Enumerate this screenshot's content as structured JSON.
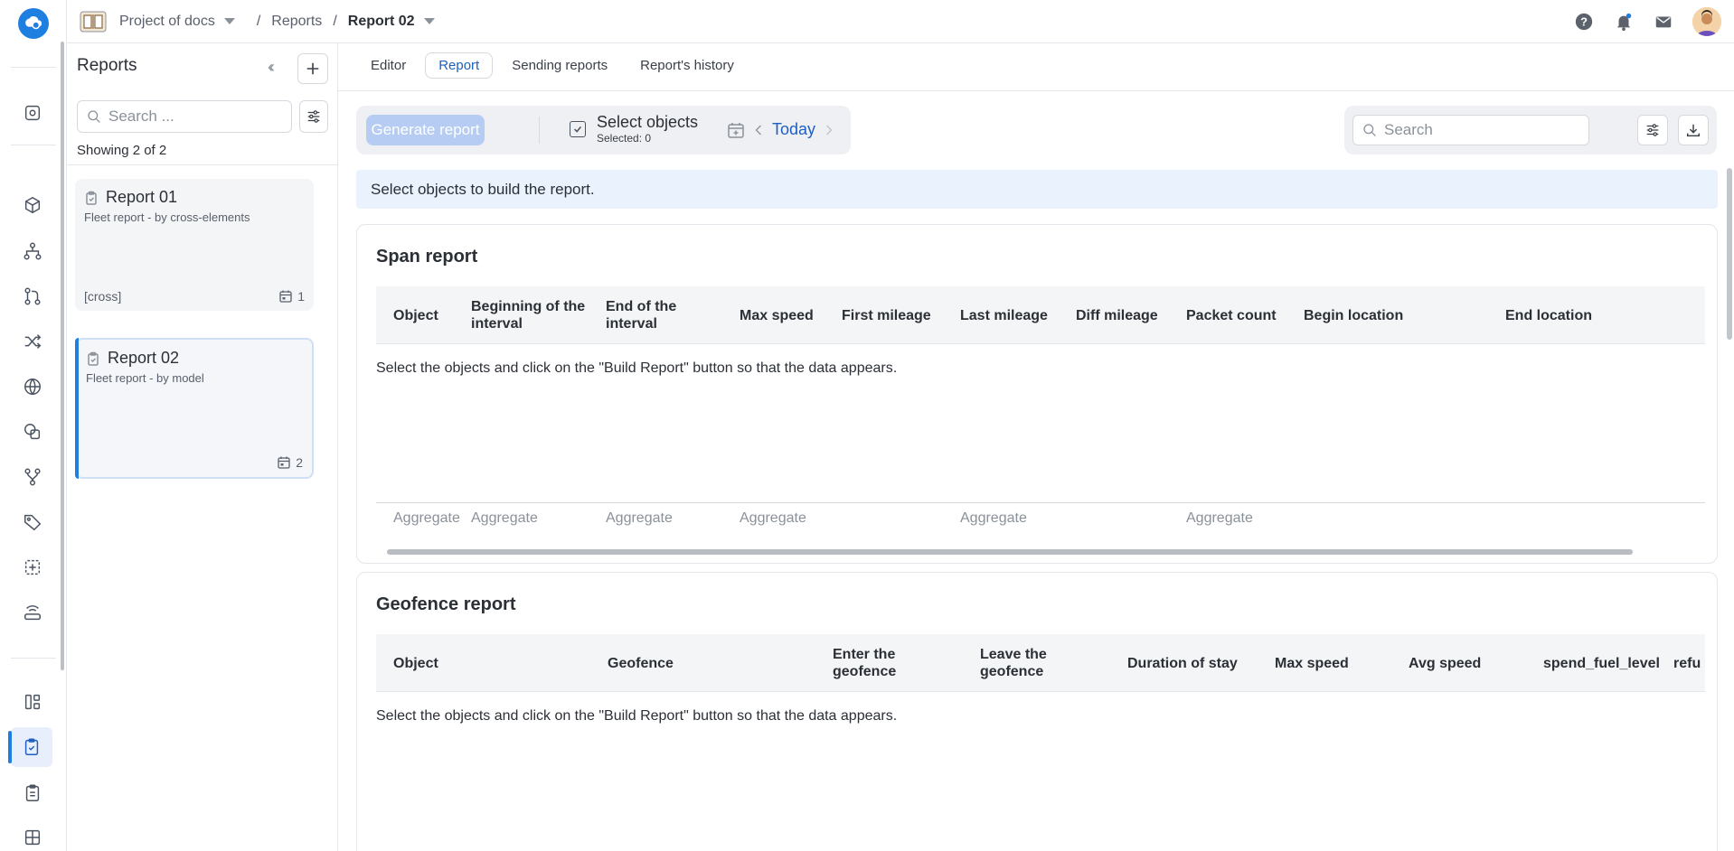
{
  "breadcrumb": {
    "project": "Project of docs",
    "section": "Reports",
    "current": "Report 02"
  },
  "sidebar": {
    "title": "Reports",
    "search_placeholder": "Search ...",
    "showing": "Showing 2 of 2",
    "reports": [
      {
        "title": "Report 01",
        "subtitle": "Fleet report - by cross-elements",
        "tag": "[cross]",
        "count": "1"
      },
      {
        "title": "Report 02",
        "subtitle": "Fleet report - by model",
        "tag": "",
        "count": "2"
      }
    ]
  },
  "tabs": [
    "Editor",
    "Report",
    "Sending reports",
    "Report's history"
  ],
  "toolbar": {
    "generate": "Generate report",
    "select_objects": "Select objects",
    "selected": "Selected: 0",
    "date": "Today",
    "search_placeholder": "Search"
  },
  "info": "Select objects to build the report.",
  "span_report": {
    "title": "Span report",
    "columns": [
      "Object",
      "Beginning of the interval",
      "End of the interval",
      "Max speed",
      "First mileage",
      "Last mileage",
      "Diff mileage",
      "Packet count",
      "Begin location",
      "End location"
    ],
    "empty": "Select the objects and click on the \"Build Report\" button so that the data appears.",
    "aggregate": "Aggregate"
  },
  "geofence_report": {
    "title": "Geofence report",
    "columns": [
      "Object",
      "Geofence",
      "Enter the geofence",
      "Leave the geofence",
      "Duration of stay",
      "Max speed",
      "Avg speed",
      "spend_fuel_level",
      "refu"
    ],
    "empty": "Select the objects and click on the \"Build Report\" button so that the data appears."
  }
}
